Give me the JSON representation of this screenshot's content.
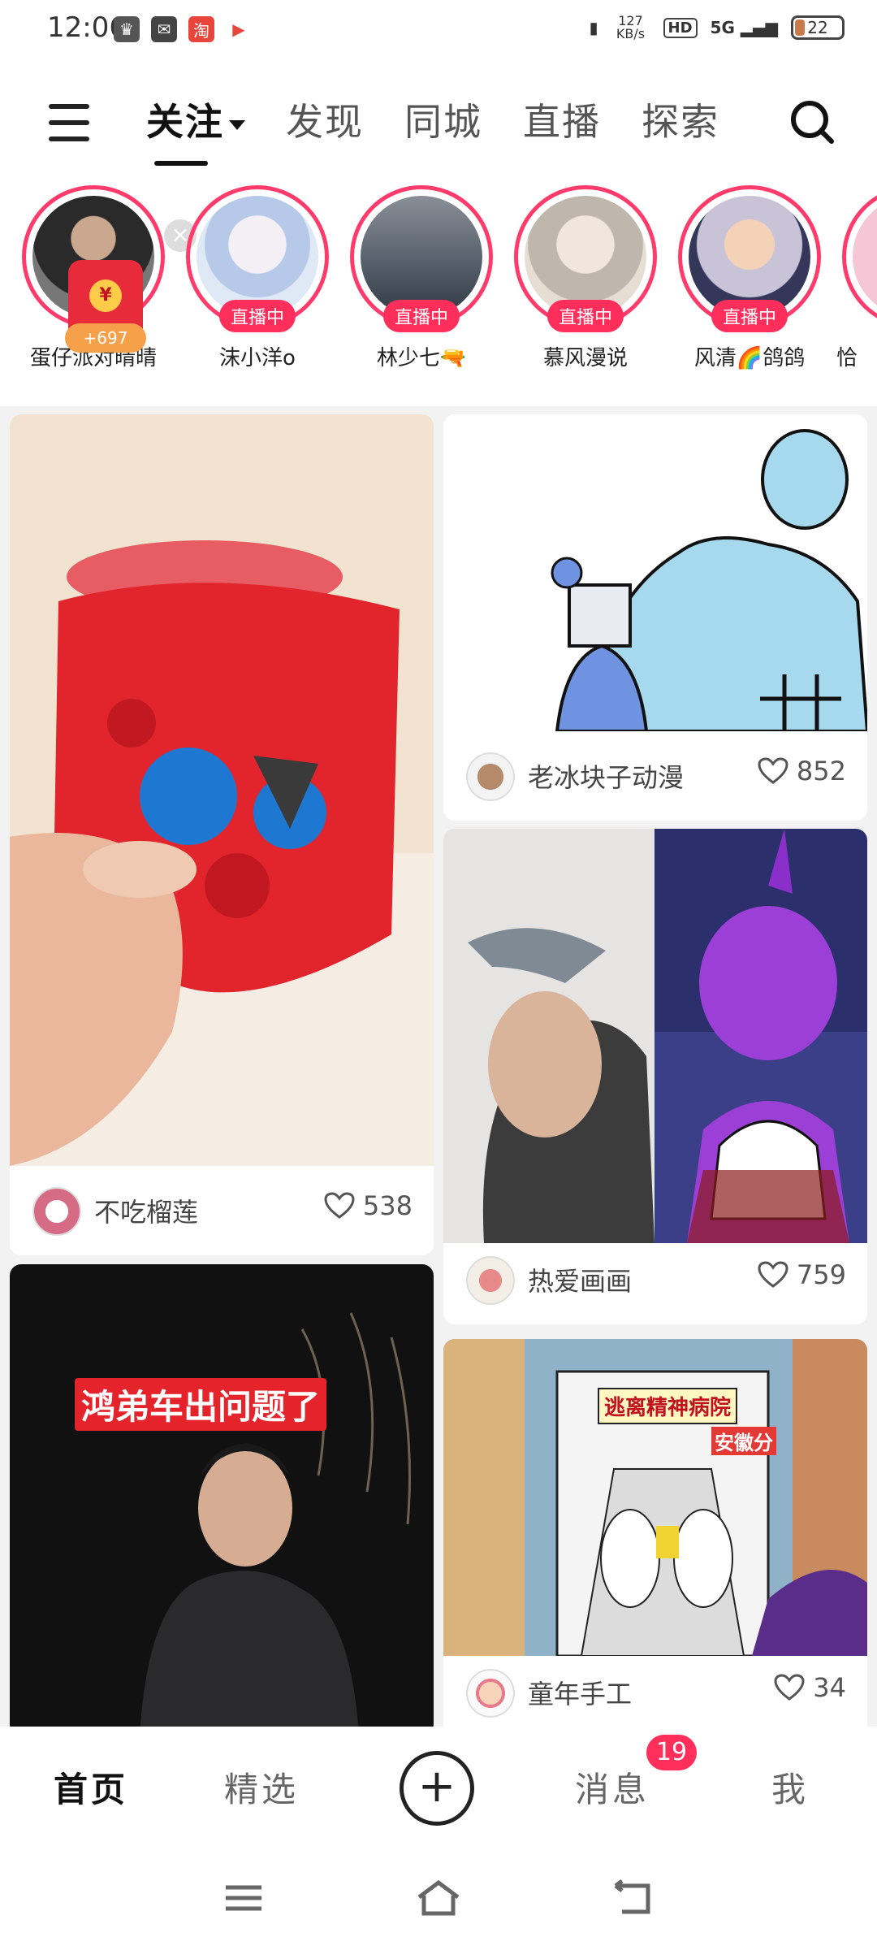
{
  "status_bar": {
    "time": "12:06",
    "net_speed": "127 KB/s",
    "hd": "HD",
    "signal": "5G",
    "battery": "22"
  },
  "top_nav": {
    "tabs": [
      {
        "label": "关注",
        "active": true
      },
      {
        "label": "发现",
        "active": false
      },
      {
        "label": "同城",
        "active": false
      },
      {
        "label": "直播",
        "active": false
      },
      {
        "label": "探索",
        "active": false
      }
    ]
  },
  "stories": [
    {
      "name": "蛋仔派对晴晴",
      "live": false,
      "red_packet": "+697"
    },
    {
      "name": "沫小洋o",
      "live": true,
      "live_label": "直播中"
    },
    {
      "name": "林少七🔫",
      "live": true,
      "live_label": "直播中"
    },
    {
      "name": "慕风漫说",
      "live": true,
      "live_label": "直播中"
    },
    {
      "name": "风清🌈鸽鸽",
      "live": true,
      "live_label": "直播中"
    },
    {
      "name": "恰",
      "live": false
    }
  ],
  "feed": {
    "cards": [
      {
        "author": "不吃榴莲",
        "likes": "538"
      },
      {
        "author": "老冰块子动漫",
        "likes": "852"
      },
      {
        "author": "热爱画画",
        "likes": "759"
      },
      {
        "author": "",
        "likes": "",
        "overlay_text": "鸿弟车出问题了"
      },
      {
        "author": "童年手工",
        "likes": "34",
        "overlay_text": "逃离精神病院",
        "overlay_sub": "安徽分"
      }
    ]
  },
  "bottom_nav": {
    "tabs": [
      {
        "label": "首页",
        "active": true
      },
      {
        "label": "精选",
        "active": false
      },
      {
        "label": "消息",
        "active": false
      },
      {
        "label": "我",
        "active": false
      }
    ],
    "messages_badge": "19"
  },
  "colors": {
    "accent": "#ff2e5b",
    "story_ring": "#ff3b6b",
    "red_packet": "#e82b3a"
  }
}
